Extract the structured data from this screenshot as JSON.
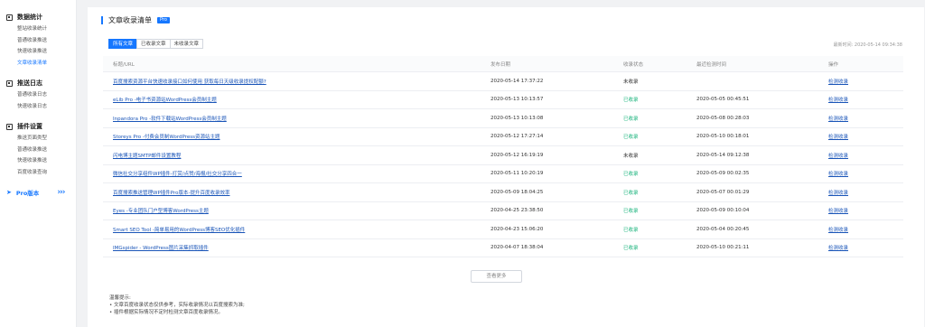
{
  "sidebar": {
    "groups": [
      {
        "title": "数据统计",
        "items": [
          "整站收录统计",
          "普通收录推送",
          "快速收录推送",
          "文章收录清单"
        ],
        "active": 3
      },
      {
        "title": "推送日志",
        "items": [
          "普通收录日志",
          "快速收录日志"
        ]
      },
      {
        "title": "插件设置",
        "items": [
          "推送页面类型",
          "普通收录推送",
          "快速收录推送",
          "百度收录查询"
        ]
      }
    ],
    "pro_label": "Pro版本"
  },
  "main": {
    "title": "文章收录清单",
    "badge": "Pro",
    "tabs": [
      "所有文章",
      "已收录文章",
      "未收录文章"
    ],
    "refresh_time": "最新时间: 2020-05-14 09:34:38",
    "columns": [
      "标题/URL",
      "发布日期",
      "收录状态",
      "最近检测时间",
      "操作"
    ],
    "rows": [
      {
        "title": "百度搜索资源平台快速收录接口如何使用 获取每日天级收录提权配额?",
        "date": "2020-05-14 17:37:22",
        "status": "未收录",
        "checked": "",
        "action": "检测收录"
      },
      {
        "title": "eLib Pro -电子书资源站WordPress会员制主题",
        "date": "2020-05-13 10:13:57",
        "status": "已收录",
        "checked": "2020-05-05 00:45:51",
        "action": "检测收录"
      },
      {
        "title": "Inpandora Pro -软件下载站WordPress会员制主题",
        "date": "2020-05-13 10:13:08",
        "status": "已收录",
        "checked": "2020-05-08 00:28:03",
        "action": "检测收录"
      },
      {
        "title": "Storeys Pro -付费会员制WordPress资源站主题",
        "date": "2020-05-12 17:27:14",
        "status": "已收录",
        "checked": "2020-05-10 00:18:01",
        "action": "检测收录"
      },
      {
        "title": "闪电博主题SMTP邮件设置教程",
        "date": "2020-05-12 16:19:19",
        "status": "未收录",
        "checked": "2020-05-14 09:12:38",
        "action": "检测收录"
      },
      {
        "title": "微信社交分享组件WP插件-打赏/点赞/海报/社交分享四合一",
        "date": "2020-05-11 10:20:19",
        "status": "已收录",
        "checked": "2020-05-09 00:02:35",
        "action": "检测收录"
      },
      {
        "title": "百度搜索推送管理WP插件Pro版本-提升百度收录效率",
        "date": "2020-05-09 18:04:25",
        "status": "已收录",
        "checked": "2020-05-07 00:01:29",
        "action": "检测收录"
      },
      {
        "title": "Eyes -专业团队门户型博客WordPress主题",
        "date": "2020-04-25 23:38:50",
        "status": "已收录",
        "checked": "2020-05-09 00:10:04",
        "action": "检测收录"
      },
      {
        "title": "Smart SEO Tool -简单易用的WordPress博客SEO优化插件",
        "date": "2020-04-23 15:06:20",
        "status": "已收录",
        "checked": "2020-05-04 00:20:45",
        "action": "检测收录"
      },
      {
        "title": "IMGspider - WordPress图片采集抓取插件",
        "date": "2020-04-07 18:38:04",
        "status": "已收录",
        "checked": "2020-05-10 00:21:11",
        "action": "检测收录"
      }
    ],
    "load_more": "查看更多",
    "notes": {
      "title": "温馨提示:",
      "lines": [
        "• 文章百度收录状态仅供参考，实际收录情况以百度搜索为准;",
        "• 插件根据实际情况不定时检测文章百度收录情况。"
      ]
    }
  },
  "colors": {
    "accent": "#1677ff",
    "indexed": "#19b37c",
    "link": "#1a55b8"
  }
}
